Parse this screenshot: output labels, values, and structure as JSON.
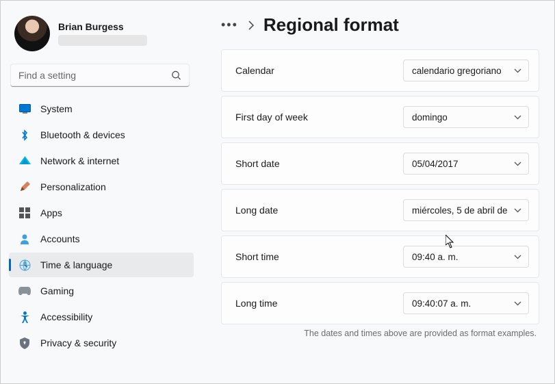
{
  "profile": {
    "name": "Brian Burgess"
  },
  "search": {
    "placeholder": "Find a setting"
  },
  "nav": {
    "system": "System",
    "bluetooth": "Bluetooth & devices",
    "network": "Network & internet",
    "personalization": "Personalization",
    "apps": "Apps",
    "accounts": "Accounts",
    "time": "Time & language",
    "gaming": "Gaming",
    "accessibility": "Accessibility",
    "privacy": "Privacy & security"
  },
  "header": {
    "title": "Regional format"
  },
  "settings": {
    "calendar": {
      "label": "Calendar",
      "value": "calendario gregoriano"
    },
    "firstday": {
      "label": "First day of week",
      "value": "domingo"
    },
    "shortdate": {
      "label": "Short date",
      "value": "05/04/2017"
    },
    "longdate": {
      "label": "Long date",
      "value": "miércoles, 5 de abril de"
    },
    "shorttime": {
      "label": "Short time",
      "value": "09:40 a. m."
    },
    "longtime": {
      "label": "Long time",
      "value": "09:40:07 a. m."
    }
  },
  "footer": "The dates and times above are provided as format examples."
}
